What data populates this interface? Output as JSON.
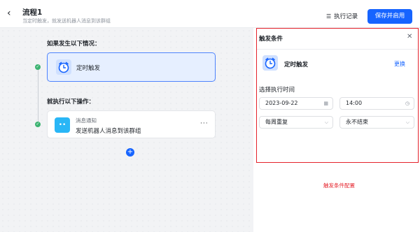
{
  "header": {
    "title": "流程1",
    "subtitle": "当定时触发，就发送机器人消息到该群组",
    "records_label": "执行记录",
    "save_label": "保存并启用"
  },
  "canvas": {
    "condition_heading": "如果发生以下情况：",
    "trigger_label": "定时触发",
    "action_heading": "就执行以下操作：",
    "action_type": "消息通知",
    "action_desc": "发送机器人消息到该群组",
    "more_label": "···",
    "add_label": "+"
  },
  "panel": {
    "title": "触发条件",
    "trigger_label": "定时触发",
    "change_label": "更换",
    "exec_time_label": "选择执行时间",
    "date_value": "2023-09-22",
    "time_value": "14:00",
    "repeat_value": "每周重复",
    "end_value": "永不结束"
  },
  "annotation": "触发条件配置",
  "colors": {
    "accent": "#1664ff",
    "highlight_box": "#e5222b",
    "success": "#3cb371"
  }
}
